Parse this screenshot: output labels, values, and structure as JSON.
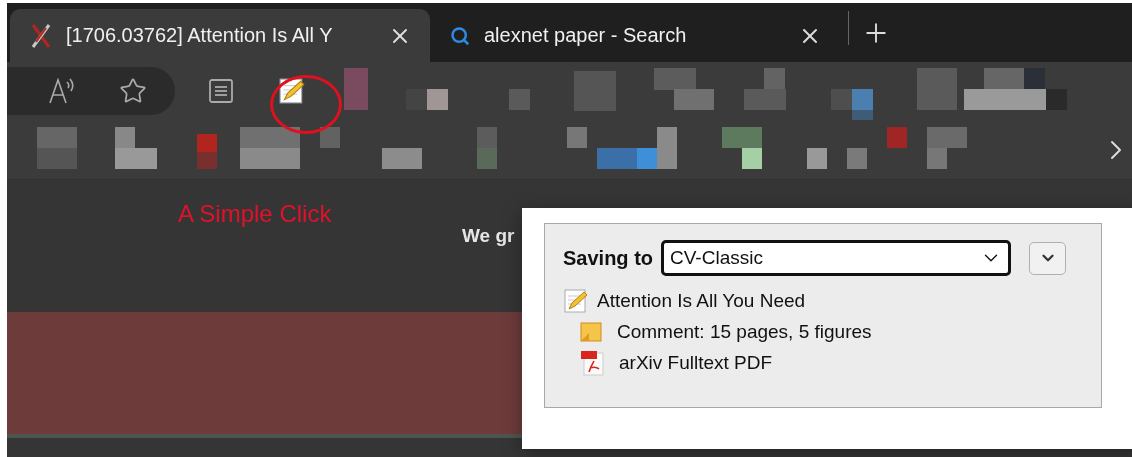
{
  "tabs": [
    {
      "kind": "logo",
      "title": "[1706.03762] Attention Is All Y",
      "selected": true
    },
    {
      "kind": "search",
      "title": "alexnet paper - Search",
      "selected": false
    }
  ],
  "annotation": {
    "label": "A Simple Click"
  },
  "page": {
    "heading_fragment": "We gr"
  },
  "popup": {
    "label": "Saving to",
    "collection": "CV-Classic",
    "items": [
      {
        "kind": "note",
        "text": "Attention Is All You Need",
        "children": [
          {
            "kind": "comment",
            "text": "Comment: 15 pages, 5 figures"
          },
          {
            "kind": "pdf",
            "text": "arXiv Fulltext PDF"
          }
        ]
      }
    ]
  }
}
